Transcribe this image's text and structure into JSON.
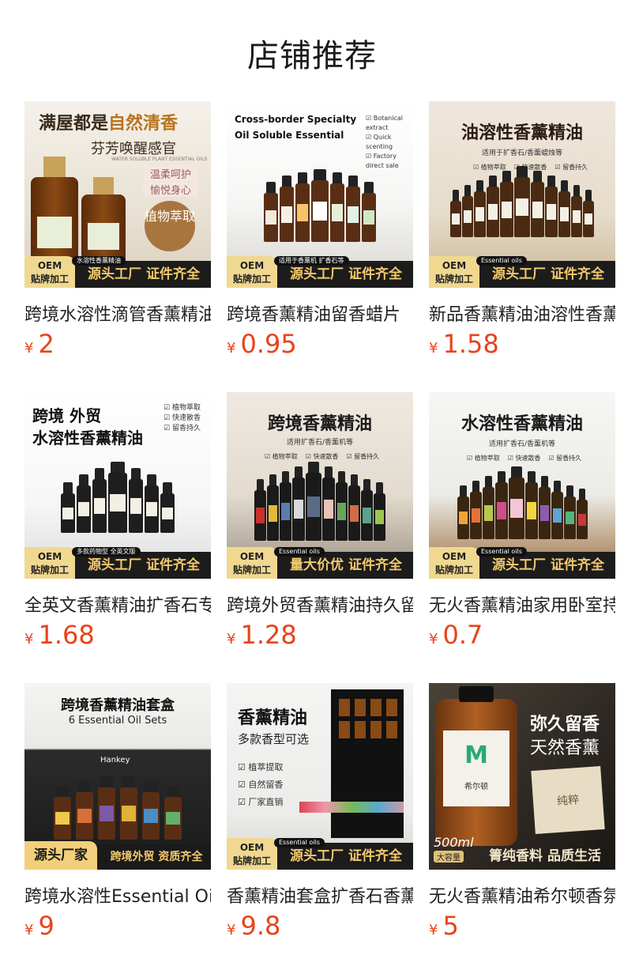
{
  "page_title": "店铺推荐",
  "products": [
    {
      "name": "跨境水溶性滴管香薰精油",
      "currency": "¥",
      "price": "2",
      "image": {
        "headline_a": "满屋都是",
        "headline_b": "自然清香",
        "sub": "芬芳唤醒感官",
        "sub_en": "WATER SOLUBLE PLANT ESSENTIAL OILS",
        "tag1": "温柔呵护",
        "tag2": "愉悦身心",
        "badge": "植物萃取",
        "oem": "OEM",
        "oem2": "贴牌加工",
        "slogan": "源头工厂 证件齐全",
        "pill": "水溶性香薰精油"
      }
    },
    {
      "name": "跨境香薰精油留香蜡片",
      "currency": "¥",
      "price": "0.95",
      "image": {
        "headline_a": "Cross-border Specialty",
        "headline_b": "Oil Soluble Essential",
        "check1": "Botanical extract",
        "check2": "Quick scenting",
        "check3": "Factory direct sale",
        "oem": "OEM",
        "oem2": "贴牌加工",
        "slogan": "源头工厂 证件齐全",
        "pill": "适用于香薰机 扩香石等"
      }
    },
    {
      "name": "新品香薰精油油溶性香薰机",
      "currency": "¥",
      "price": "1.58",
      "image": {
        "headline_a": "油溶性香薰精油",
        "sub": "适用于扩香石/香薰蜡烛等",
        "check1": "植物萃取",
        "check2": "快速散香",
        "check3": "留香持久",
        "oem": "OEM",
        "oem2": "贴牌加工",
        "slogan": "源头工厂 证件齐全",
        "pill": "Essential oils"
      }
    },
    {
      "name": "全英文香薰精油扩香石专用",
      "currency": "¥",
      "price": "1.68",
      "image": {
        "headline_a": "跨境 外贸",
        "headline_b": "水溶性香薰精油",
        "check1": "植物萃取",
        "check2": "快速散香",
        "check3": "留香持久",
        "oem": "OEM",
        "oem2": "贴牌加工",
        "slogan": "源头工厂 证件齐全",
        "pill": "多款药物型 全英文版"
      }
    },
    {
      "name": "跨境外贸香薰精油持久留香",
      "currency": "¥",
      "price": "1.28",
      "image": {
        "headline_a": "跨境香薰精油",
        "sub": "适用扩香石/香薰机等",
        "check1": "植物萃取",
        "check2": "快速散香",
        "check3": "留香持久",
        "oem": "OEM",
        "oem2": "贴牌加工",
        "slogan": "量大价优 证件齐全",
        "pill": "Essential oils"
      }
    },
    {
      "name": "无火香薰精油家用卧室持久",
      "currency": "¥",
      "price": "0.7",
      "image": {
        "headline_a": "水溶性香薰精油",
        "sub": "适用扩香石/香薰机等",
        "check1": "植物萃取",
        "check2": "快速散香",
        "check3": "留香持久",
        "oem": "OEM",
        "oem2": "贴牌加工",
        "slogan": "源头工厂 证件齐全",
        "pill": "Essential oils"
      }
    },
    {
      "name": "跨境水溶性Essential Oil",
      "currency": "¥",
      "price": "9",
      "image": {
        "headline_a": "跨境香薰精油套盒",
        "headline_b": "6 Essential Oil Sets",
        "box_brand": "Hankey",
        "slogan_a": "源头厂家",
        "slogan": "跨境外贸 资质齐全"
      }
    },
    {
      "name": "香薰精油套盒扩香石香薰机",
      "currency": "¥",
      "price": "9.8",
      "image": {
        "headline_a": "香薰精油",
        "sub": "多款香型可选",
        "check1": "植萃提取",
        "check2": "自然留香",
        "check3": "厂家直销",
        "oem": "OEM",
        "oem2": "贴牌加工",
        "slogan": "源头工厂 证件齐全",
        "pill": "Essential oils"
      }
    },
    {
      "name": "无火香薰精油希尔顿香氛",
      "currency": "¥",
      "price": "5",
      "image": {
        "headline_a": "弥久留香",
        "headline_b": "天然香薰",
        "bottle_label": "希尔顿",
        "volume": "500ml",
        "volume_tag": "大容量",
        "note": "纯粹",
        "slogan": "箐纯香料 品质生活"
      }
    }
  ]
}
